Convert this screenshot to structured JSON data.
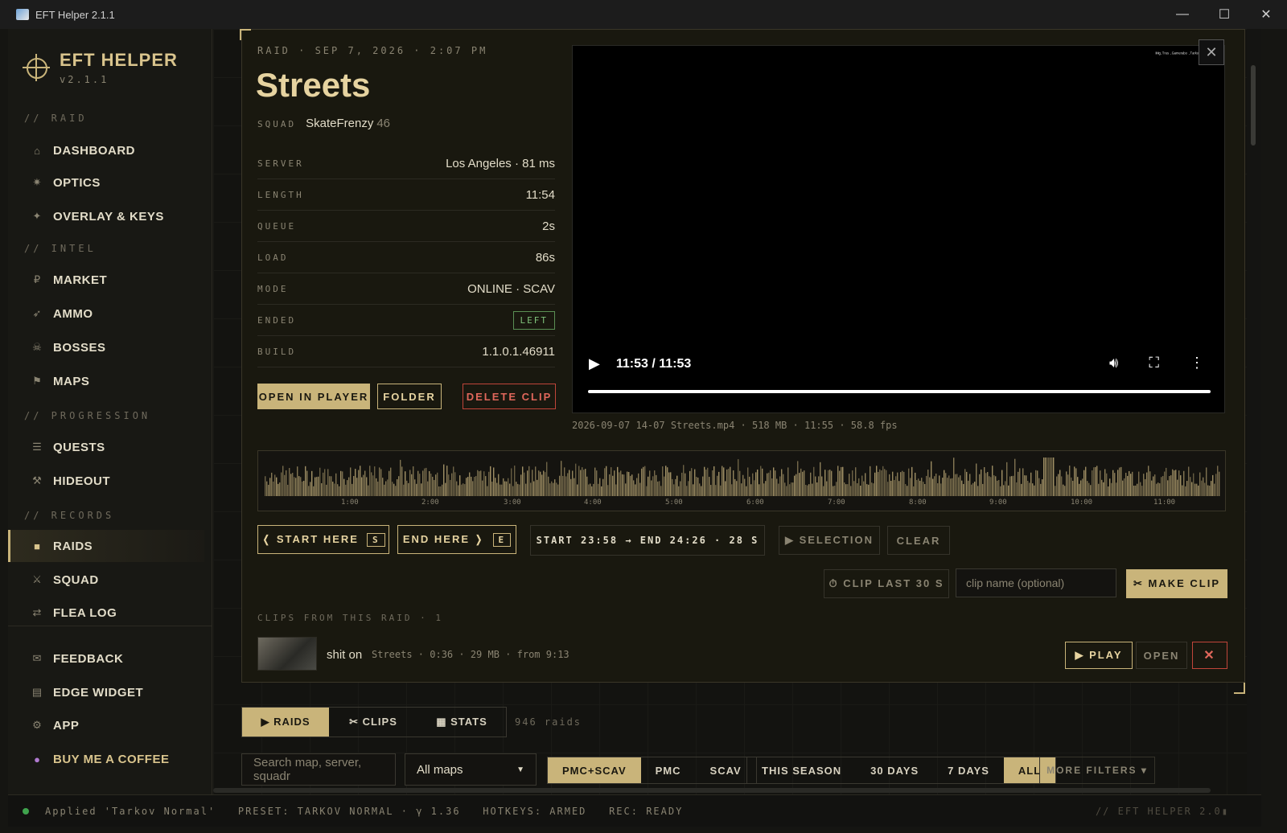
{
  "window": {
    "title": "EFT Helper 2.1.1",
    "controls": [
      "—",
      "☐",
      "✕"
    ]
  },
  "brand": {
    "name": "EFT HELPER",
    "version": "v2.1.1"
  },
  "sidebar": {
    "sections": [
      "// RAID",
      "// INTEL",
      "// PROGRESSION",
      "// RECORDS"
    ],
    "items": [
      {
        "icon": "⌂",
        "label": "DASHBOARD"
      },
      {
        "icon": "✷",
        "label": "OPTICS"
      },
      {
        "icon": "✦",
        "label": "OVERLAY & KEYS"
      },
      {
        "icon": "₽",
        "label": "MARKET"
      },
      {
        "icon": "➶",
        "label": "AMMO"
      },
      {
        "icon": "☠",
        "label": "BOSSES"
      },
      {
        "icon": "⚑",
        "label": "MAPS"
      },
      {
        "icon": "☰",
        "label": "QUESTS"
      },
      {
        "icon": "⚒",
        "label": "HIDEOUT"
      },
      {
        "icon": "■",
        "label": "RAIDS"
      },
      {
        "icon": "⚔",
        "label": "SQUAD"
      },
      {
        "icon": "⇄",
        "label": "FLEA LOG"
      }
    ],
    "bottom": [
      {
        "icon": "✉",
        "label": "FEEDBACK"
      },
      {
        "icon": "▤",
        "label": "EDGE WIDGET"
      },
      {
        "icon": "⚙",
        "label": "APP"
      },
      {
        "icon": "●",
        "label": "BUY ME A COFFEE"
      }
    ]
  },
  "raid": {
    "meta": "RAID · SEP 7, 2026 · 2:07 PM",
    "map": "Streets",
    "squad_label": "SQUAD",
    "squad_name": "SkateFrenzy",
    "squad_level": "46",
    "details": [
      {
        "key": "SERVER",
        "value": "Los Angeles · 81 ms"
      },
      {
        "key": "LENGTH",
        "value": "11:54"
      },
      {
        "key": "QUEUE",
        "value": "2s"
      },
      {
        "key": "LOAD",
        "value": "86s"
      },
      {
        "key": "MODE",
        "value": "ONLINE · SCAV"
      },
      {
        "key": "ENDED",
        "value": "LEFT"
      },
      {
        "key": "BUILD",
        "value": "1.1.0.1.46911"
      }
    ],
    "actions": {
      "open": "OPEN IN PLAYER",
      "folder": "FOLDER",
      "delete": "DELETE CLIP"
    }
  },
  "video": {
    "time": "11:53 / 11:53",
    "watermark": "ᴵᴹᵍ·ᵀʳᵉˢ ·ᴳᵃᵐᵉʳᵃᵇᵒ ·ᵀᵃʳᵏᵒᵛ",
    "progress": 1.0,
    "file_info": "2026-09-07 14-07 Streets.mp4 · 518 MB · 11:55 · 58.8 fps"
  },
  "timeline": {
    "ticks": [
      "1:00",
      "2:00",
      "3:00",
      "4:00",
      "5:00",
      "6:00",
      "7:00",
      "8:00",
      "9:00",
      "10:00",
      "11:00"
    ]
  },
  "clip_controls": {
    "start": "❬ START HERE",
    "start_key": "S",
    "end": "END HERE ❭",
    "end_key": "E",
    "range": "START 23:58 → END 24:26 · 28 S",
    "selection": "▶ SELECTION",
    "clear": "CLEAR",
    "clip_last": "⏱ CLIP LAST 30 S",
    "clip_name_placeholder": "clip name (optional)",
    "make_clip": "✂ MAKE CLIP"
  },
  "clips": {
    "heading": "CLIPS FROM THIS RAID · 1",
    "items": [
      {
        "title": "shit on",
        "meta": "Streets · 0:36 · 29 MB · from 9:13"
      }
    ],
    "play": "▶ PLAY",
    "open": "OPEN",
    "delete": "✕"
  },
  "bottom_tabs": {
    "tabs": [
      "▶ RAIDS",
      "✂ CLIPS",
      "▦ STATS"
    ],
    "count": "946 raids"
  },
  "filters": {
    "search_placeholder": "Search map, server, squadr",
    "map_select": "All maps",
    "type": [
      "PMC+SCAV",
      "PMC",
      "SCAV"
    ],
    "period": [
      "THIS SEASON",
      "30 DAYS",
      "7 DAYS",
      "ALL"
    ],
    "more": "MORE FILTERS ▾"
  },
  "status": {
    "text": "Applied 'Tarkov Normal'   PRESET: TARKOV NORMAL · γ 1.36   HOTKEYS: ARMED   REC: READY",
    "right": "// EFT HELPER 2.0▮"
  }
}
